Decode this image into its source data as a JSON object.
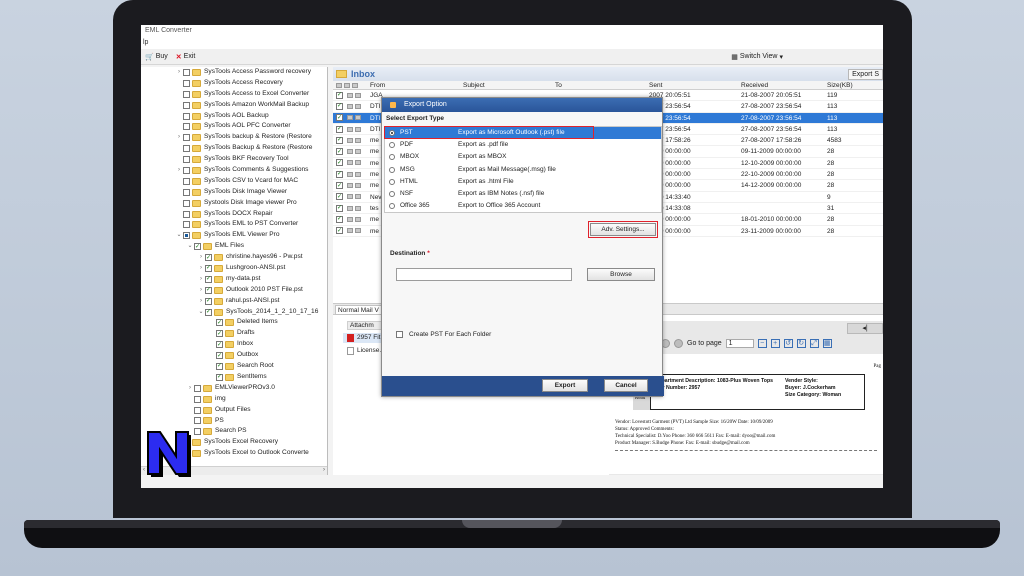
{
  "app": {
    "window_title": "EML Converter",
    "menu_fragment": "lp"
  },
  "toolbar": {
    "buy": "Buy",
    "exit": "Exit",
    "switch_view": "Switch View",
    "switch_view_caret": "▾"
  },
  "tree": {
    "items": [
      {
        "label": "SysTools Access Password recovery",
        "level": 0,
        "chev": "›",
        "checked": false,
        "partial": false,
        "folder": true
      },
      {
        "label": "SysTools Access Recovery",
        "level": 0,
        "chev": "",
        "checked": false,
        "partial": false,
        "folder": true
      },
      {
        "label": "SysTools Access to Excel Converter",
        "level": 0,
        "chev": "",
        "checked": false,
        "partial": false,
        "folder": true
      },
      {
        "label": "SysTools Amazon WorkMail Backup",
        "level": 0,
        "chev": "",
        "checked": false,
        "partial": false,
        "folder": true
      },
      {
        "label": "SysTools AOL Backup",
        "level": 0,
        "chev": "",
        "checked": false,
        "partial": false,
        "folder": true
      },
      {
        "label": "SysTools AOL PFC Converter",
        "level": 0,
        "chev": "",
        "checked": false,
        "partial": false,
        "folder": true
      },
      {
        "label": "SysTools backup & Restore (Restore",
        "level": 0,
        "chev": "›",
        "checked": false,
        "partial": false,
        "folder": true
      },
      {
        "label": "SysTools Backup & Restore (Restore",
        "level": 0,
        "chev": "",
        "checked": false,
        "partial": false,
        "folder": true
      },
      {
        "label": "SysTools BKF Recovery Tool",
        "level": 0,
        "chev": "",
        "checked": false,
        "partial": false,
        "folder": true
      },
      {
        "label": "SysTools Comments & Suggestions",
        "level": 0,
        "chev": "›",
        "checked": false,
        "partial": false,
        "folder": true
      },
      {
        "label": "SysTools CSV to Vcard for MAC",
        "level": 0,
        "chev": "",
        "checked": false,
        "partial": false,
        "folder": true
      },
      {
        "label": "SysTools Disk Image Viewer",
        "level": 0,
        "chev": "",
        "checked": false,
        "partial": false,
        "folder": true
      },
      {
        "label": "Systools Disk Image viewer Pro",
        "level": 0,
        "chev": "",
        "checked": false,
        "partial": false,
        "folder": true
      },
      {
        "label": "SysTools DOCX Repair",
        "level": 0,
        "chev": "",
        "checked": false,
        "partial": false,
        "folder": true
      },
      {
        "label": "SysTools EML to PST Converter",
        "level": 0,
        "chev": "",
        "checked": false,
        "partial": false,
        "folder": true
      },
      {
        "label": "SysTools EML Viewer Pro",
        "level": 0,
        "chev": "⌄",
        "checked": false,
        "partial": true,
        "folder": true
      },
      {
        "label": "EML Files",
        "level": 1,
        "chev": "⌄",
        "checked": true,
        "partial": false,
        "folder": true
      },
      {
        "label": "christine.hayes96 - Pw.pst",
        "level": 2,
        "chev": "›",
        "checked": true,
        "partial": false,
        "folder": true
      },
      {
        "label": "Lushgroon-ANSI.pst",
        "level": 2,
        "chev": "›",
        "checked": true,
        "partial": false,
        "folder": true
      },
      {
        "label": "my-data.pst",
        "level": 2,
        "chev": "›",
        "checked": true,
        "partial": false,
        "folder": true
      },
      {
        "label": "Outlook 2010 PST File.pst",
        "level": 2,
        "chev": "›",
        "checked": true,
        "partial": false,
        "folder": true
      },
      {
        "label": "rahul.pst-ANSI.pst",
        "level": 2,
        "chev": "›",
        "checked": true,
        "partial": false,
        "folder": true
      },
      {
        "label": "SysTools_2014_1_2_10_17_16",
        "level": 2,
        "chev": "⌄",
        "checked": true,
        "partial": false,
        "folder": true
      },
      {
        "label": "Deleted Items",
        "level": 3,
        "chev": "",
        "checked": true,
        "partial": false,
        "folder": true
      },
      {
        "label": "Drafts",
        "level": 3,
        "chev": "",
        "checked": true,
        "partial": false,
        "folder": true
      },
      {
        "label": "Inbox",
        "level": 3,
        "chev": "",
        "checked": true,
        "partial": false,
        "folder": true
      },
      {
        "label": "Outbox",
        "level": 3,
        "chev": "",
        "checked": true,
        "partial": false,
        "folder": true
      },
      {
        "label": "Search Root",
        "level": 3,
        "chev": "",
        "checked": true,
        "partial": false,
        "folder": true
      },
      {
        "label": "SentItems",
        "level": 3,
        "chev": "",
        "checked": true,
        "partial": false,
        "folder": true
      },
      {
        "label": "EMLViewerPROv3.0",
        "level": 1,
        "chev": "›",
        "checked": false,
        "partial": false,
        "folder": true
      },
      {
        "label": "img",
        "level": 1,
        "chev": "",
        "checked": false,
        "partial": false,
        "folder": true
      },
      {
        "label": "Output Files",
        "level": 1,
        "chev": "",
        "checked": false,
        "partial": false,
        "folder": true
      },
      {
        "label": "PS",
        "level": 1,
        "chev": "",
        "checked": false,
        "partial": false,
        "folder": true
      },
      {
        "label": "Search PS",
        "level": 1,
        "chev": "",
        "checked": false,
        "partial": false,
        "folder": true
      },
      {
        "label": "SysTools Excel Recovery",
        "level": 0,
        "chev": "",
        "checked": false,
        "partial": false,
        "folder": true
      },
      {
        "label": "SysTools Excel to Outlook Converte",
        "level": 0,
        "chev": "",
        "checked": false,
        "partial": false,
        "folder": true
      }
    ],
    "scroll_left": "‹",
    "scroll_right": "›"
  },
  "inbox": {
    "title": "Inbox",
    "export_label": "Export S",
    "columns": {
      "from": "From",
      "subject": "Subject",
      "to": "To",
      "sent": "Sent",
      "received": "Received",
      "size": "Size(KB)"
    },
    "rows": [
      {
        "from": "JGA",
        "subject": "",
        "to": "",
        "sent": "2007 20:05:51",
        "received": "21-08-2007 20:05:51",
        "size": "119",
        "selected": false
      },
      {
        "from": "DTI",
        "subject": "",
        "to": "",
        "sent": "2007 23:56:54",
        "received": "27-08-2007 23:56:54",
        "size": "113",
        "selected": false
      },
      {
        "from": "DTI",
        "subject": "",
        "to": "",
        "sent": "2007 23:56:54",
        "received": "27-08-2007 23:56:54",
        "size": "113",
        "selected": true
      },
      {
        "from": "DTI",
        "subject": "",
        "to": "",
        "sent": "2007 23:56:54",
        "received": "27-08-2007 23:56:54",
        "size": "113",
        "selected": false
      },
      {
        "from": "me",
        "subject": "",
        "to": "",
        "sent": "2007 17:58:26",
        "received": "27-08-2007 17:58:26",
        "size": "4583",
        "selected": false
      },
      {
        "from": "me",
        "subject": "",
        "to": "",
        "sent": "2009 00:00:00",
        "received": "09-11-2009 00:00:00",
        "size": "28",
        "selected": false
      },
      {
        "from": "me",
        "subject": "",
        "to": "",
        "sent": "2009 00:00:00",
        "received": "12-10-2009 00:00:00",
        "size": "28",
        "selected": false
      },
      {
        "from": "me",
        "subject": "",
        "to": "",
        "sent": "2009 00:00:00",
        "received": "22-10-2009 00:00:00",
        "size": "28",
        "selected": false
      },
      {
        "from": "me",
        "subject": "",
        "to": "",
        "sent": "2009 00:00:00",
        "received": "14-12-2009 00:00:00",
        "size": "28",
        "selected": false
      },
      {
        "from": "Nev",
        "subject": "",
        "to": "",
        "sent": "2010 14:33:40",
        "received": "",
        "size": "9",
        "selected": false
      },
      {
        "from": "tes",
        "subject": "",
        "to": "",
        "sent": "2010 14:33:08",
        "received": "",
        "size": "31",
        "selected": false
      },
      {
        "from": "me",
        "subject": "",
        "to": "",
        "sent": "2009 00:00:00",
        "received": "18-01-2010 00:00:00",
        "size": "28",
        "selected": false
      },
      {
        "from": "me",
        "subject": "",
        "to": "",
        "sent": "2009 00:00:00",
        "received": "23-11-2009 00:00:00",
        "size": "28",
        "selected": false
      }
    ]
  },
  "lower": {
    "tab_label": "Normal Mail V",
    "attach_header": "Attachm",
    "attachments": [
      "2957 Fit S",
      "License.t"
    ],
    "goto_label": "Go to page",
    "page_value": "1",
    "nav_label": "◂|"
  },
  "document": {
    "dept_line": "Department Description: 1083-Plus Woven Tops",
    "dev_line": "Dev Number: 2957",
    "vendor_style": "Vender Style:",
    "buyer": "Buyer: J.Cockerham",
    "size_category": "Size Category: Woman",
    "read_label": "Read",
    "page_fragment": "Pag",
    "r1": "Vendor:      Lovestott Garment (PVT) Ltd     Sample Size:  16/20W      Date:  10/09/2009",
    "r2": "Status:       Approved                                  Comments:",
    "r3": "Technical Specialist:  D.Yoo     Phone:   360 666 5611    Fax:              E-mail:  dyoo@mail.com",
    "r4": "Product Manager:   S.Budge    Phone:                            Fax:              E-mail:  sbudge@mail.com"
  },
  "dialog": {
    "title": "Export Option",
    "section_label": "Select Export Type",
    "options": [
      {
        "name": "PST",
        "desc": "Export as Microsoft Outlook (.pst) file",
        "selected": true
      },
      {
        "name": "PDF",
        "desc": "Export as .pdf file",
        "selected": false
      },
      {
        "name": "MBOX",
        "desc": "Export as MBOX",
        "selected": false
      },
      {
        "name": "MSG",
        "desc": "Export as Mail Message(.msg) file",
        "selected": false
      },
      {
        "name": "HTML",
        "desc": "Export as .html File",
        "selected": false
      },
      {
        "name": "NSF",
        "desc": "Export as IBM Notes (.nsf) file",
        "selected": false
      },
      {
        "name": "Office 365",
        "desc": "Export to Office 365 Account",
        "selected": false
      }
    ],
    "adv_settings": "Adv. Settings...",
    "destination_label": "Destination",
    "required_mark": "*",
    "destination_value": "",
    "browse": "Browse",
    "create_pst_label": "Create PST For Each Folder",
    "export_button": "Export",
    "cancel_button": "Cancel",
    "highlight_color": "#e0222c"
  },
  "brand": {
    "logo_letter": "N",
    "logo_color": "#2c2cf0"
  }
}
